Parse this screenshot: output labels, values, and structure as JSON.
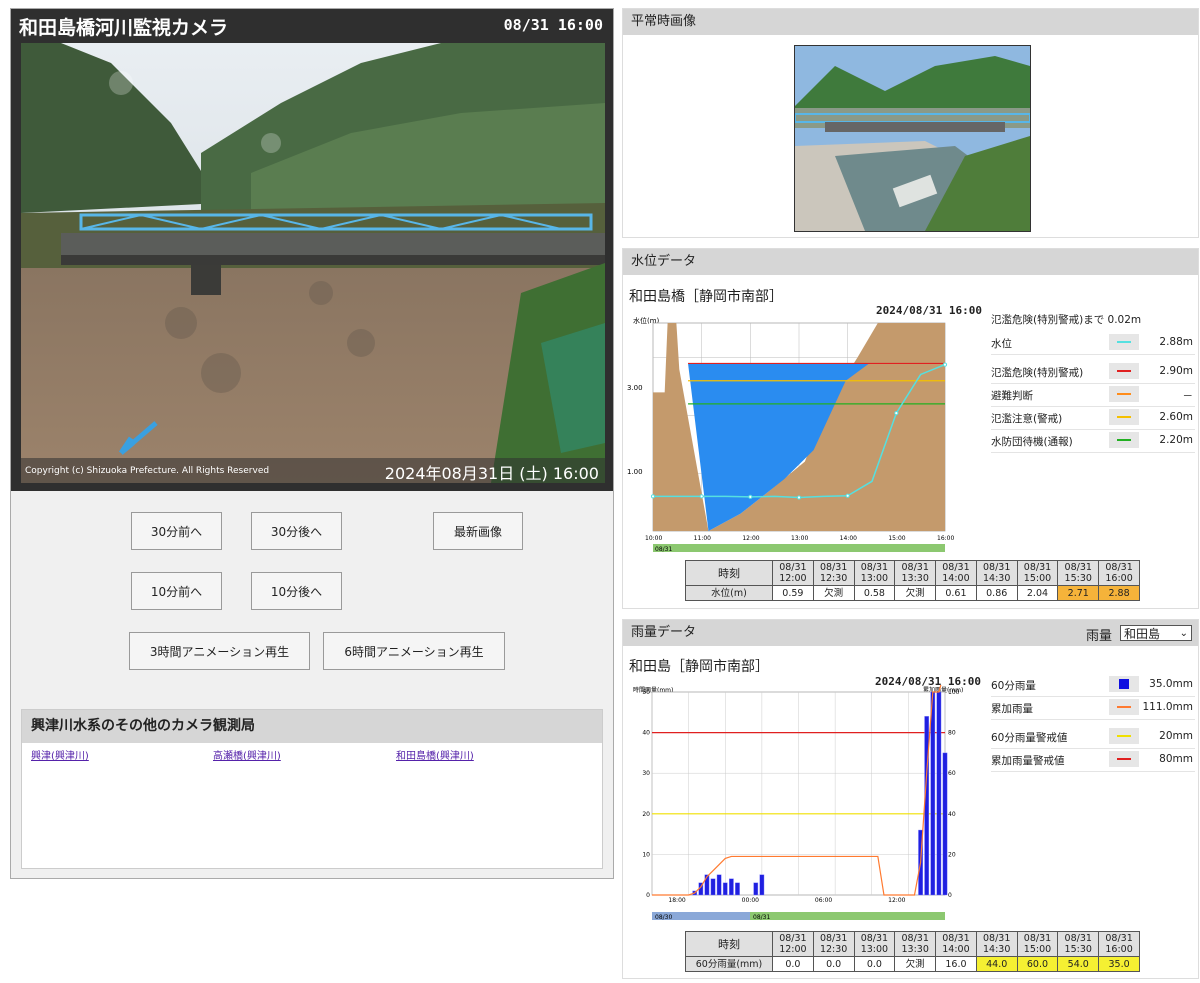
{
  "camera": {
    "title": "和田島橋河川監視カメラ",
    "time": "08/31 16:00",
    "copyright": "Copyright (c) Shizuoka Prefecture. All Rights Reserved",
    "overlay_timestamp": "2024年08月31日 (土) 16:00",
    "buttons": {
      "prev30": "30分前へ",
      "next30": "30分後へ",
      "latest": "最新画像",
      "prev10": "10分前へ",
      "next10": "10分後へ",
      "anim3h": "3時間アニメーション再生",
      "anim6h": "6時間アニメーション再生"
    },
    "other_cameras": {
      "title": "興津川水系のその他のカメラ観測局",
      "links": [
        "興津(興津川)",
        "高瀬橋(興津川)",
        "和田島橋(興津川)"
      ]
    }
  },
  "normal_image": {
    "title": "平常時画像"
  },
  "water": {
    "title": "水位データ",
    "station": "和田島橋［静岡市南部］",
    "timestamp": "2024/08/31 16:00",
    "y_axis_label": "水位(m)",
    "y_ticks": [
      "3.00",
      "1.00"
    ],
    "x_ticks": [
      "10:00",
      "11:00",
      "12:00",
      "13:00",
      "14:00",
      "15:00",
      "16:00"
    ],
    "date_label": "08/31",
    "note": "氾濫危険(特別警戒)まで 0.02m",
    "legend": [
      {
        "label": "水位",
        "value": "2.88m",
        "color": "#55e0e0"
      },
      {
        "label": "氾濫危険(特別警戒)",
        "value": "2.90m",
        "color": "#e02020"
      },
      {
        "label": "避難判断",
        "value": "－",
        "color": "#ff8c1a"
      },
      {
        "label": "氾濫注意(警戒)",
        "value": "2.60m",
        "color": "#f5c000"
      },
      {
        "label": "水防団待機(通報)",
        "value": "2.20m",
        "color": "#22b022"
      }
    ],
    "table": {
      "header_label": "時刻",
      "row_label": "水位(m)",
      "times": [
        "08/31 12:00",
        "08/31 12:30",
        "08/31 13:00",
        "08/31 13:30",
        "08/31 14:00",
        "08/31 14:30",
        "08/31 15:00",
        "08/31 15:30",
        "08/31 16:00"
      ],
      "values": [
        "0.59",
        "欠測",
        "0.58",
        "欠測",
        "0.61",
        "0.86",
        "2.04",
        "2.71",
        "2.88"
      ],
      "highlight": [
        false,
        false,
        false,
        false,
        false,
        false,
        false,
        true,
        true
      ]
    }
  },
  "rain": {
    "title": "雨量データ",
    "select_label": "雨量",
    "select_value": "和田島",
    "station": "和田島［静岡市南部］",
    "timestamp": "2024/08/31 16:00",
    "y_left_label": "時間雨量(mm)",
    "y_right_label": "累加雨量(mm)",
    "y_left_ticks": [
      "50",
      "40",
      "30",
      "20",
      "10",
      "0"
    ],
    "y_right_ticks": [
      "100",
      "80",
      "60",
      "40",
      "20",
      "0"
    ],
    "x_ticks": [
      "18:00",
      "00:00",
      "06:00",
      "12:00"
    ],
    "date_labels": [
      "08/30",
      "08/31"
    ],
    "legend": [
      {
        "label": "60分雨量",
        "value": "35.0mm",
        "color": "#1010e0"
      },
      {
        "label": "累加雨量",
        "value": "111.0mm",
        "color": "#ff7a30"
      },
      {
        "label": "60分雨量警戒値",
        "value": "20mm",
        "color": "#f0e000"
      },
      {
        "label": "累加雨量警戒値",
        "value": "80mm",
        "color": "#e02020"
      }
    ],
    "table": {
      "header_label": "時刻",
      "row_label": "60分雨量(mm)",
      "times": [
        "08/31 12:00",
        "08/31 12:30",
        "08/31 13:00",
        "08/31 13:30",
        "08/31 14:00",
        "08/31 14:30",
        "08/31 15:00",
        "08/31 15:30",
        "08/31 16:00"
      ],
      "values": [
        "0.0",
        "0.0",
        "0.0",
        "欠測",
        "16.0",
        "44.0",
        "60.0",
        "54.0",
        "35.0"
      ],
      "highlight": [
        false,
        false,
        false,
        false,
        false,
        true,
        true,
        true,
        true
      ]
    }
  },
  "chart_data": [
    {
      "type": "area",
      "title": "",
      "ylabel": "水位(m)",
      "x": [
        "10:00",
        "10:30",
        "11:00",
        "11:30",
        "12:00",
        "12:30",
        "13:00",
        "13:30",
        "14:00",
        "14:30",
        "15:00",
        "15:30",
        "16:00"
      ],
      "series": [
        {
          "name": "水位",
          "values": [
            0.6,
            0.6,
            0.6,
            0.6,
            0.59,
            0.6,
            0.58,
            0.6,
            0.61,
            0.86,
            2.04,
            2.71,
            2.88
          ]
        }
      ],
      "thresholds": {
        "氾濫危険(特別警戒)": 2.9,
        "氾濫注意(警戒)": 2.6,
        "水防団待機(通報)": 2.2
      }
    },
    {
      "type": "bar",
      "title": "",
      "ylabel": "時間雨量(mm)",
      "x": [
        "16:00",
        "16:30",
        "17:00",
        "17:30",
        "18:00",
        "18:30",
        "19:00",
        "19:30",
        "20:00",
        "20:30",
        "21:00",
        "21:30",
        "22:00",
        "22:30",
        "23:00",
        "23:30",
        "00:00",
        "00:30",
        "01:00",
        "01:30",
        "02:00",
        "02:30",
        "03:00",
        "03:30",
        "04:00",
        "04:30",
        "05:00",
        "05:30",
        "06:00",
        "06:30",
        "07:00",
        "07:30",
        "08:00",
        "08:30",
        "09:00",
        "09:30",
        "10:00",
        "10:30",
        "11:00",
        "11:30",
        "12:00",
        "12:30",
        "13:00",
        "13:30",
        "14:00",
        "14:30",
        "15:00",
        "15:30",
        "16:00"
      ],
      "series": [
        {
          "name": "60分雨量",
          "values": [
            0,
            0,
            0,
            0,
            0,
            0,
            0,
            1,
            3,
            5,
            4,
            5,
            3,
            4,
            3,
            0,
            0,
            3,
            5,
            0,
            0,
            0,
            0,
            0,
            0,
            0,
            0,
            0,
            0,
            0,
            0,
            0,
            0,
            0,
            0,
            0,
            0,
            0,
            0,
            0,
            0,
            0,
            0,
            0,
            16,
            44,
            60,
            54,
            35
          ]
        },
        {
          "name": "累加雨量",
          "values": [
            0,
            0,
            0,
            0,
            0,
            0,
            0,
            1,
            4,
            9,
            12,
            15,
            18,
            19,
            19,
            19,
            19,
            19,
            19,
            19,
            19,
            19,
            19,
            19,
            19,
            19,
            19,
            19,
            19,
            19,
            19,
            19,
            19,
            19,
            19,
            19,
            19,
            19,
            0,
            0,
            0,
            0,
            0,
            0,
            16,
            60,
            100,
            100,
            111
          ]
        }
      ],
      "thresholds": {
        "60分雨量警戒値": 20,
        "累加雨量警戒値": 80
      },
      "ylim": [
        0,
        50
      ],
      "ylim_right": [
        0,
        100
      ]
    }
  ]
}
